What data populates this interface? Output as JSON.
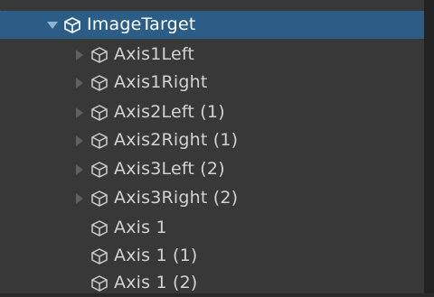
{
  "colors": {
    "background": "#383838",
    "selected_row": "#2c5d87",
    "text": "#d2d2d2",
    "selected_text": "#ffffff",
    "arrow": "#6b6b6b",
    "icon": "#cfcfcf"
  },
  "hierarchy": {
    "root": {
      "label": "ImageTarget",
      "icon": "cube-icon",
      "expanded": true,
      "selected": true
    },
    "children": [
      {
        "label": "Axis1Left",
        "icon": "cube-icon",
        "has_children": true
      },
      {
        "label": "Axis1Right",
        "icon": "cube-icon",
        "has_children": true
      },
      {
        "label": "Axis2Left (1)",
        "icon": "cube-icon",
        "has_children": true
      },
      {
        "label": "Axis2Right (1)",
        "icon": "cube-icon",
        "has_children": true
      },
      {
        "label": "Axis3Left (2)",
        "icon": "cube-icon",
        "has_children": true
      },
      {
        "label": "Axis3Right (2)",
        "icon": "cube-icon",
        "has_children": true
      },
      {
        "label": "Axis 1",
        "icon": "cube-icon",
        "has_children": false
      },
      {
        "label": "Axis 1 (1)",
        "icon": "cube-icon",
        "has_children": false
      },
      {
        "label": "Axis 1 (2)",
        "icon": "cube-icon",
        "has_children": false
      }
    ]
  }
}
